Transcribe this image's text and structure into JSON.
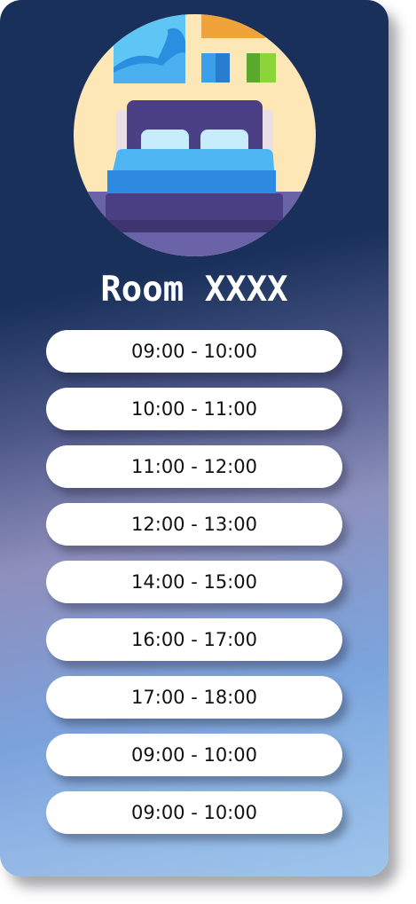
{
  "room": {
    "title": "Room XXXX",
    "image_icon": "bed-icon"
  },
  "slots": [
    "09:00 - 10:00",
    "10:00 - 11:00",
    "11:00 - 12:00",
    "12:00 - 13:00",
    "14:00 - 15:00",
    "16:00 - 17:00",
    "17:00 - 18:00",
    "09:00 - 10:00",
    "09:00 - 10:00"
  ],
  "colors": {
    "card_top": "#18305a",
    "card_bottom": "#b0c8ee",
    "slot_background": "#ffffff",
    "title_text": "#ffffff"
  }
}
